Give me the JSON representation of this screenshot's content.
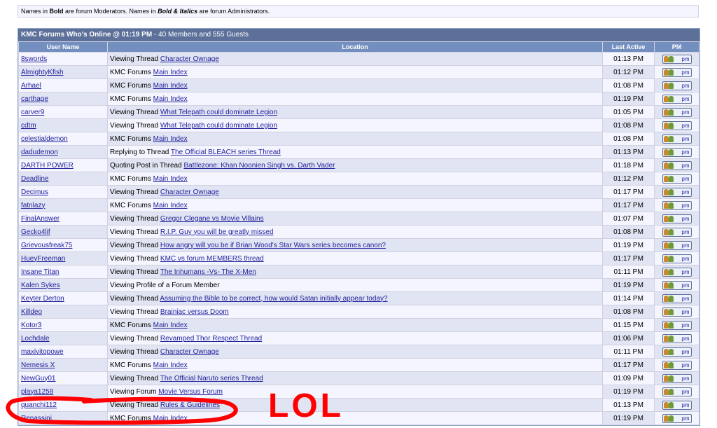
{
  "legend": {
    "pre": "Names in ",
    "bold": "Bold",
    "mid": " are forum Moderators. Names in ",
    "bolditalic": "Bold & Italics",
    "post": " are forum Administrators."
  },
  "panel": {
    "title": "KMC Forums Who's Online @ 01:19 PM",
    "subtitle": " - 40 Members and 555 Guests"
  },
  "headers": {
    "user": "User Name",
    "location": "Location",
    "active": "Last Active",
    "pm": "PM"
  },
  "pm_label": "pm",
  "rows": [
    {
      "user": "8swords",
      "action": "Viewing Thread ",
      "link": "Character Ownage",
      "time": "01:13 PM"
    },
    {
      "user": "AlmightyKfish",
      "action": "KMC Forums ",
      "link": "Main Index",
      "time": "01:12 PM"
    },
    {
      "user": "Arhael",
      "action": "KMC Forums ",
      "link": "Main Index",
      "time": "01:08 PM"
    },
    {
      "user": "carthage",
      "action": "KMC Forums ",
      "link": "Main Index",
      "time": "01:19 PM"
    },
    {
      "user": "carver9",
      "action": "Viewing Thread ",
      "link": "What Telepath could dominate Legion",
      "time": "01:05 PM"
    },
    {
      "user": "cdtm",
      "action": "Viewing Thread ",
      "link": "What Telepath could dominate Legion",
      "time": "01:08 PM"
    },
    {
      "user": "celestialdemon",
      "action": "KMC Forums ",
      "link": "Main Index",
      "time": "01:08 PM"
    },
    {
      "user": "dadudemon",
      "action": "Replying to Thread ",
      "link": "The Official BLEACH series Thread",
      "time": "01:13 PM"
    },
    {
      "user": "DARTH POWER",
      "action": "Quoting Post in Thread ",
      "link": "Battlezone: Khan Noonien Singh vs. Darth Vader",
      "time": "01:18 PM"
    },
    {
      "user": "Deadline",
      "action": "KMC Forums ",
      "link": "Main Index",
      "time": "01:12 PM"
    },
    {
      "user": "Decimus",
      "action": "Viewing Thread ",
      "link": "Character Ownage",
      "time": "01:17 PM"
    },
    {
      "user": "fatnlazy",
      "action": "KMC Forums ",
      "link": "Main Index",
      "time": "01:17 PM"
    },
    {
      "user": "FinalAnswer",
      "action": "Viewing Thread ",
      "link": "Gregor Clegane vs Movie Villains",
      "time": "01:07 PM"
    },
    {
      "user": "Gecko4lif",
      "action": "Viewing Thread ",
      "link": "R.I.P. Guy you will be greatly missed",
      "time": "01:08 PM"
    },
    {
      "user": "Grievousfreak75",
      "action": "Viewing Thread ",
      "link": "How angry will you be if Brian Wood's Star Wars series becomes canon?",
      "time": "01:19 PM"
    },
    {
      "user": "HueyFreeman",
      "action": "Viewing Thread ",
      "link": "KMC vs forum MEMBERS thread",
      "time": "01:17 PM"
    },
    {
      "user": "Insane Titan",
      "action": "Viewing Thread ",
      "link": "The Inhumans -Vs- The X-Men",
      "time": "01:11 PM"
    },
    {
      "user": "Kalen Sykes",
      "action": "Viewing Profile of a Forum Member",
      "link": "",
      "time": "01:19 PM"
    },
    {
      "user": "Keyter Derton",
      "action": "Viewing Thread ",
      "link": "Assuming the Bible to be correct, how would Satan initially appear today?",
      "time": "01:14 PM"
    },
    {
      "user": "Killdeo",
      "action": "Viewing Thread ",
      "link": "Brainiac versus Doom",
      "time": "01:08 PM"
    },
    {
      "user": "Kotor3",
      "action": "KMC Forums ",
      "link": "Main Index",
      "time": "01:15 PM"
    },
    {
      "user": "Lochdale",
      "action": "Viewing Thread ",
      "link": "Revamped Thor Respect Thread",
      "time": "01:06 PM"
    },
    {
      "user": "maxivitopowe",
      "action": "Viewing Thread ",
      "link": "Character Ownage",
      "time": "01:11 PM"
    },
    {
      "user": "Nemesis X",
      "action": "KMC Forums ",
      "link": "Main Index",
      "time": "01:17 PM"
    },
    {
      "user": "NewGuy01",
      "action": "Viewing Thread ",
      "link": "The Official Naruto series Thread",
      "time": "01:09 PM"
    },
    {
      "user": "playa1258",
      "action": "Viewing Forum ",
      "link": "Movie Versus Forum",
      "time": "01:19 PM"
    },
    {
      "user": "quanchi112",
      "action": "Viewing Thread ",
      "link": "Rules & Guidelines",
      "time": "01:13 PM"
    },
    {
      "user": "Renassini",
      "action": "KMC Forums ",
      "link": "Main Index",
      "time": "01:19 PM"
    }
  ],
  "annotation": {
    "text": "LOL",
    "color": "#ff0000"
  }
}
